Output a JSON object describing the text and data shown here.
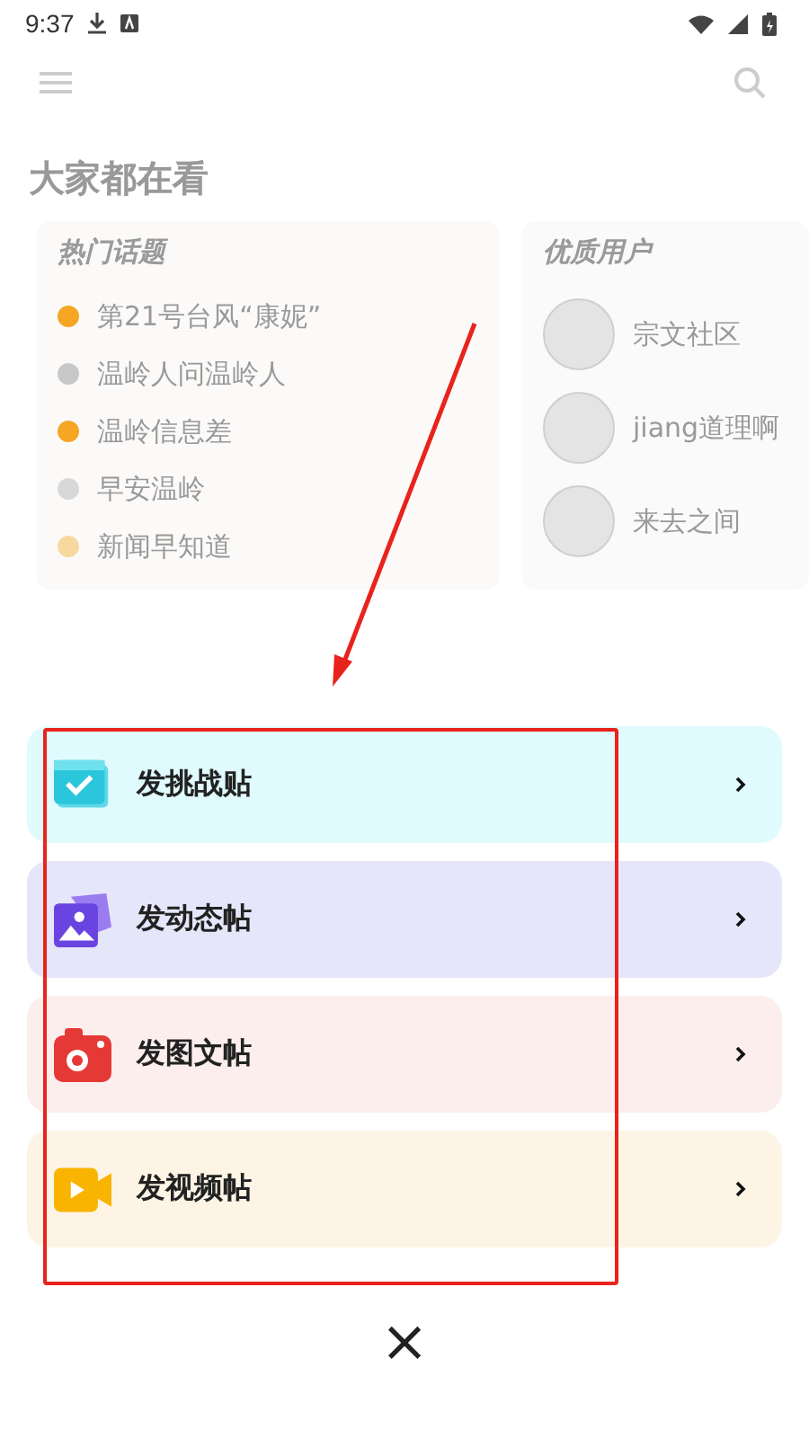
{
  "status_bar": {
    "time": "9:37"
  },
  "section": {
    "title": "大家都在看"
  },
  "hot_topics": {
    "title": "热门话题",
    "items": [
      {
        "label": "第21号台风“康妮”",
        "color": "#f5a623"
      },
      {
        "label": "温岭人问温岭人",
        "color": "#c8c8c8"
      },
      {
        "label": "温岭信息差",
        "color": "#f5a623"
      },
      {
        "label": "早安温岭",
        "color": "#d8d8d8"
      },
      {
        "label": "新闻早知道",
        "color": "#f7d9a0"
      }
    ]
  },
  "top_users": {
    "title": "优质用户",
    "items": [
      {
        "name": "宗文社区"
      },
      {
        "name": "jiang道理啊"
      },
      {
        "name": "来去之间"
      }
    ]
  },
  "post_options": [
    {
      "kind": "challenge",
      "label": "发挑战贴",
      "color": "#e0fbfd"
    },
    {
      "kind": "moment",
      "label": "发动态帖",
      "color": "#e6e6fb"
    },
    {
      "kind": "photo",
      "label": "发图文帖",
      "color": "#fdeeee"
    },
    {
      "kind": "video",
      "label": "发视频帖",
      "color": "#fdf4e6"
    }
  ],
  "close_label": "×"
}
